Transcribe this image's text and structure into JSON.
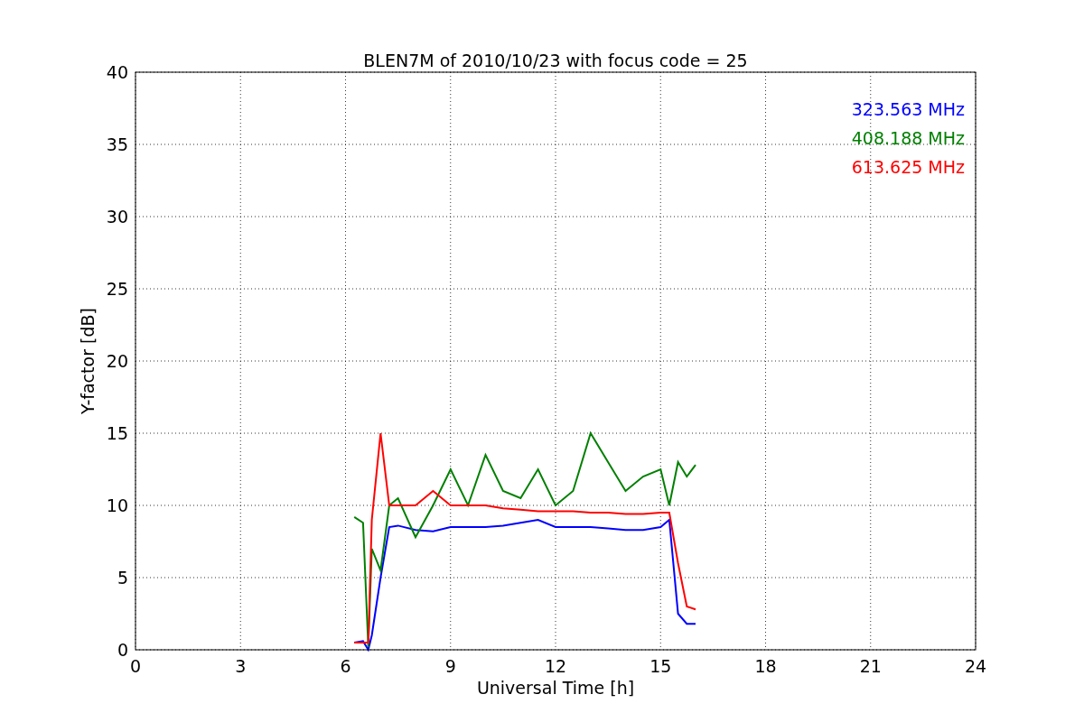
{
  "chart": {
    "chart_data": {
      "type": "line",
      "title": "BLEN7M of 2010/10/23 with focus code = 25",
      "xlabel": "Universal Time [h]",
      "ylabel": "Y-factor [dB]",
      "xlim": [
        0,
        24
      ],
      "ylim": [
        0,
        40
      ],
      "xticks": [
        0,
        3,
        6,
        9,
        12,
        15,
        18,
        21,
        24
      ],
      "yticks": [
        0,
        5,
        10,
        15,
        20,
        25,
        30,
        35,
        40
      ],
      "grid": true,
      "x": [
        6.25,
        6.5,
        6.65,
        6.75,
        7,
        7.25,
        7.5,
        8,
        8.5,
        9,
        9.5,
        10,
        10.5,
        11,
        11.5,
        12,
        12.5,
        13,
        13.5,
        14,
        14.5,
        15,
        15.25,
        15.5,
        15.75,
        16
      ],
      "series": [
        {
          "name": "323.563 MHz",
          "color": "#0000ff",
          "values": [
            0.5,
            0.6,
            0,
            1,
            5,
            8.5,
            8.6,
            8.3,
            8.2,
            8.5,
            8.5,
            8.5,
            8.6,
            8.8,
            9,
            8.5,
            8.5,
            8.5,
            8.4,
            8.3,
            8.3,
            8.5,
            9,
            2.5,
            1.8,
            1.8
          ]
        },
        {
          "name": "408.188 MHz",
          "color": "#008000",
          "values": [
            9.2,
            8.8,
            0.2,
            7,
            5.5,
            10,
            10.5,
            7.8,
            10,
            12.5,
            10,
            13.5,
            11,
            10.5,
            12.5,
            10,
            11,
            15,
            13,
            11,
            12,
            12.5,
            10,
            13,
            12,
            12.8
          ]
        },
        {
          "name": "613.625 MHz",
          "color": "#ff0000",
          "values": [
            0.5,
            0.5,
            0.5,
            9,
            15,
            10,
            10,
            10,
            11,
            10,
            10,
            10,
            9.8,
            9.7,
            9.6,
            9.6,
            9.6,
            9.5,
            9.5,
            9.4,
            9.4,
            9.5,
            9.5,
            6,
            3,
            2.8
          ]
        }
      ]
    }
  }
}
